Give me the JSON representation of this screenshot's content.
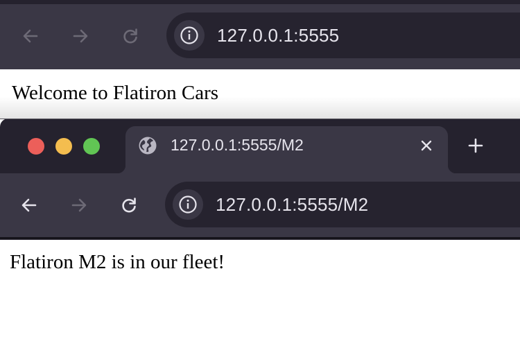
{
  "window1": {
    "address_bar": {
      "url": "127.0.0.1:5555"
    },
    "page": {
      "text": "Welcome to Flatiron Cars"
    }
  },
  "window2": {
    "traffic_lights": {
      "close_color": "#ec5f5a",
      "minimize_color": "#f4bd4f",
      "zoom_color": "#61c554"
    },
    "tab": {
      "title": "127.0.0.1:5555/M2",
      "close_glyph": "×"
    },
    "new_tab_glyph": "+",
    "address_bar": {
      "url": "127.0.0.1:5555/M2"
    },
    "page": {
      "text": "Flatiron M2 is in our fleet!"
    }
  },
  "icons": [
    "back-arrow-icon",
    "forward-arrow-icon",
    "reload-icon",
    "info-icon",
    "globe-icon",
    "close-icon",
    "plus-icon"
  ],
  "colors": {
    "toolbar": "#3a3745",
    "frame": "#25222e",
    "omnibox": "#26232f",
    "text_light": "#e6e4ec"
  }
}
